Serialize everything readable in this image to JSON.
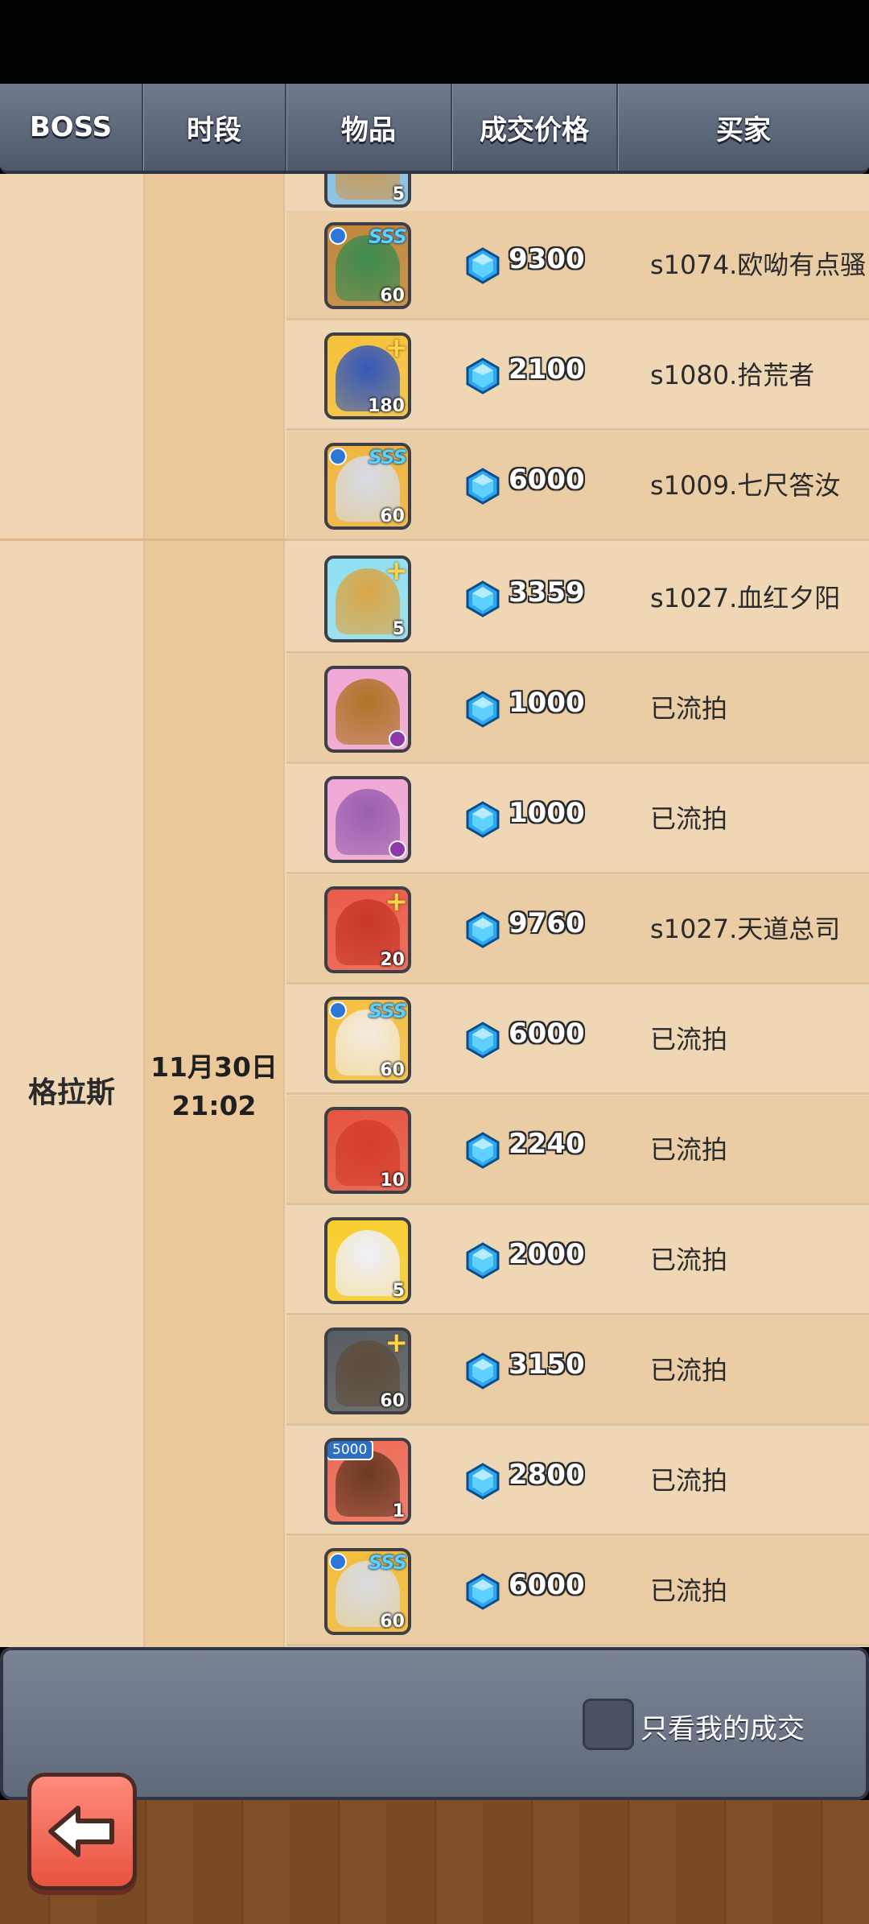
{
  "header": {
    "col_boss": "BOSS",
    "col_time": "时段",
    "col_item": "物品",
    "col_price": "成交价格",
    "col_buyer": "买家"
  },
  "groups": [
    {
      "boss": "",
      "time_date": "",
      "time_clock": ""
    },
    {
      "boss": "格拉斯",
      "time_date": "11月30日",
      "time_clock": "21:02"
    }
  ],
  "rows": [
    {
      "level": "5",
      "badge": "",
      "price": "",
      "buyer": "",
      "art": "#c99a58",
      "bg": "#7fc1ec"
    },
    {
      "level": "60",
      "badge": "SSS",
      "price": "9300",
      "buyer": "s1074.欧呦有点骚",
      "art": "#3f8a4f",
      "bg": "#c0873a"
    },
    {
      "level": "180",
      "badge": "+",
      "price": "2100",
      "buyer": "s1080.拾荒者",
      "art": "#3559b8",
      "bg": "#f6c23a"
    },
    {
      "level": "60",
      "badge": "SSS",
      "price": "6000",
      "buyer": "s1009.七尺答汝",
      "art": "#d7dce6",
      "bg": "#f0b640"
    },
    {
      "level": "5",
      "badge": "+",
      "price": "3359",
      "buyer": "s1027.血红夕阳",
      "art": "#d9a647",
      "bg": "#8fe1f5"
    },
    {
      "level": "",
      "badge": "",
      "price": "1000",
      "buyer": "已流拍",
      "art": "#b07326",
      "bg": "#f1a8d8"
    },
    {
      "level": "",
      "badge": "",
      "price": "1000",
      "buyer": "已流拍",
      "art": "#9a5fb0",
      "bg": "#f1a8d8"
    },
    {
      "level": "20",
      "badge": "+",
      "price": "9760",
      "buyer": "s1027.天道总司",
      "art": "#c8382a",
      "bg": "#ec5b4c"
    },
    {
      "level": "60",
      "badge": "SSS",
      "price": "6000",
      "buyer": "已流拍",
      "art": "#f3ece0",
      "bg": "#f5c043"
    },
    {
      "level": "10",
      "badge": "",
      "price": "2240",
      "buyer": "已流拍",
      "art": "#d53d2c",
      "bg": "#e65441"
    },
    {
      "level": "5",
      "badge": "",
      "price": "2000",
      "buyer": "已流拍",
      "art": "#f0f1fb",
      "bg": "#f8cf2e"
    },
    {
      "level": "60",
      "badge": "+",
      "price": "3150",
      "buyer": "已流拍",
      "art": "#5e4e3d",
      "bg": "#555c63"
    },
    {
      "level": "1",
      "badge": "5000",
      "price": "2800",
      "buyer": "已流拍",
      "art": "#6a3b25",
      "bg": "#ee6a58"
    },
    {
      "level": "60",
      "badge": "SSS",
      "price": "6000",
      "buyer": "已流拍",
      "art": "#d9dde2",
      "bg": "#f3bd3c"
    }
  ],
  "footer": {
    "only_mine_label": "只看我的成交"
  },
  "icons": {
    "gem": "diamond-gem-icon",
    "back": "arrow-left-icon"
  }
}
